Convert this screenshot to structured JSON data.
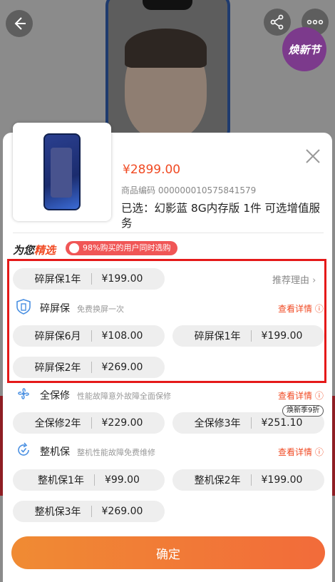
{
  "background": {
    "badge_text": "焕新节"
  },
  "product": {
    "price": "¥2899.00",
    "code": "商品编码 000000010575841579",
    "selected": "已选：幻影蓝  8G内存版  1件  可选增值服务"
  },
  "pick": {
    "title_part1": "为您",
    "title_part2": "精选",
    "pill": "98%购买的用户同时选购"
  },
  "recommended": {
    "name": "碎屏保1年",
    "price": "¥199.00",
    "reason": "推荐理由"
  },
  "services": [
    {
      "name": "碎屏保",
      "desc": "免费换屏一次",
      "detail": "查看详情",
      "options": [
        {
          "name": "碎屏保6月",
          "price": "¥108.00"
        },
        {
          "name": "碎屏保1年",
          "price": "¥199.00"
        },
        {
          "name": "碎屏保2年",
          "price": "¥269.00"
        }
      ]
    },
    {
      "name": "全保修",
      "desc": "性能故障意外故障全面保修",
      "detail": "查看详情",
      "options": [
        {
          "name": "全保修2年",
          "price": "¥229.00"
        },
        {
          "name": "全保修3年",
          "price": "¥251.10",
          "tag": "焕新季9折"
        }
      ]
    },
    {
      "name": "整机保",
      "desc": "整机性能故障免费维修",
      "detail": "查看详情",
      "options": [
        {
          "name": "整机保1年",
          "price": "¥99.00"
        },
        {
          "name": "整机保2年",
          "price": "¥199.00"
        },
        {
          "name": "整机保3年",
          "price": "¥269.00"
        }
      ]
    }
  ],
  "confirm_label": "确定",
  "icons": {
    "back": "back-arrow-icon",
    "share": "share-icon",
    "more": "more-icon",
    "close": "close-icon",
    "shield": "shield-icon",
    "fan": "fan-icon",
    "refresh": "refresh-icon",
    "flame": "flame-icon",
    "help": "help-icon"
  },
  "colors": {
    "accent": "#f04a23",
    "button_from": "#f08b33",
    "button_to": "#f26b3a",
    "highlight": "#e51919",
    "service_icon": "#4a90e2"
  }
}
